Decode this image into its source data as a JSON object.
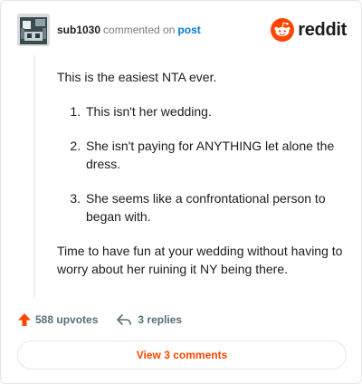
{
  "header": {
    "username": "sub1030",
    "action": "commented on",
    "target": "post",
    "brand": "reddit"
  },
  "comment": {
    "intro": "This is the easiest NTA ever.",
    "items": [
      "This isn't her wedding.",
      "She isn't paying for ANYTHING let alone the dress.",
      "She seems like a confrontational person to began with."
    ],
    "closing": "Time to have fun at your wedding without having to worry about her ruining it NY being there."
  },
  "footer": {
    "upvotes_count": "588",
    "upvotes_label": "upvotes",
    "replies_label": "3 replies",
    "view_button": "View 3 comments"
  },
  "colors": {
    "accent": "#ff4500",
    "link": "#0079d3",
    "muted": "#576f76"
  }
}
